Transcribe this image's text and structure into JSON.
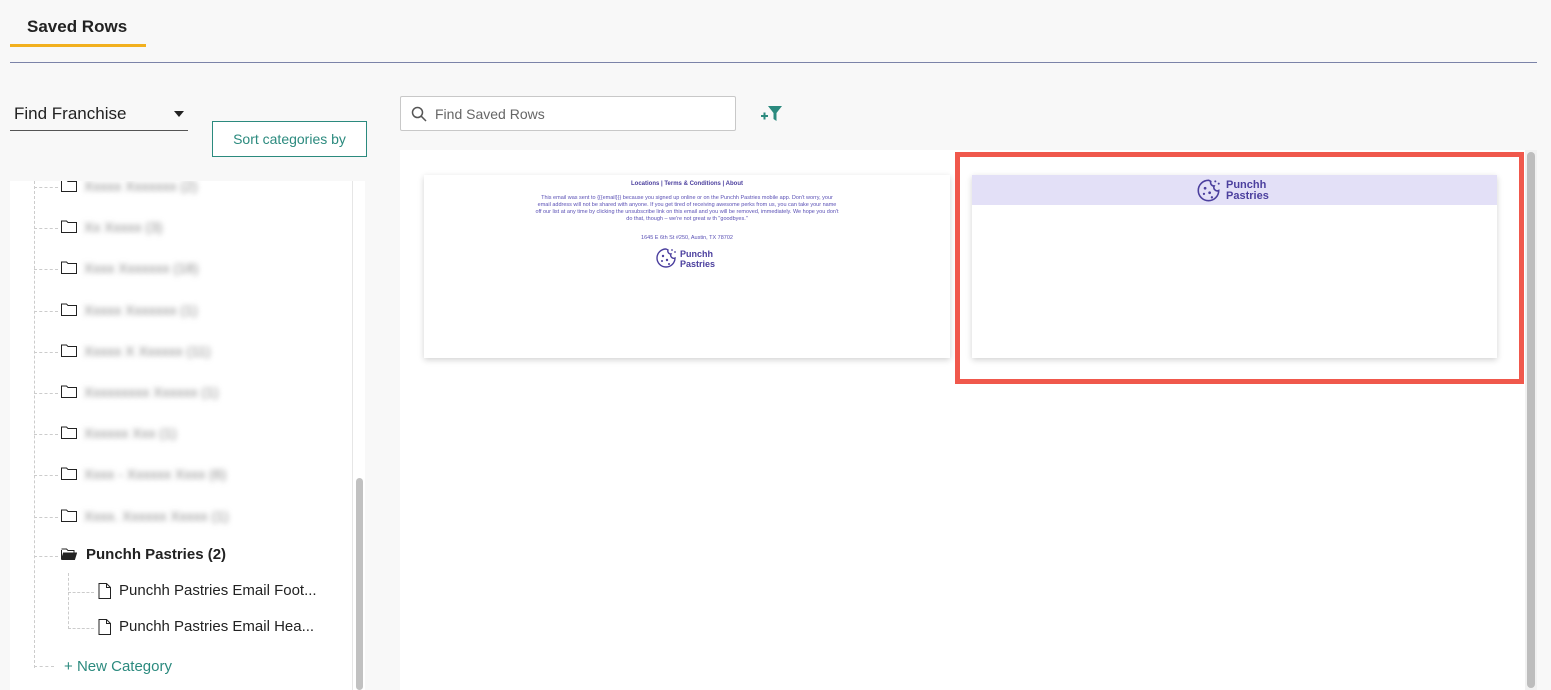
{
  "tab": {
    "label": "Saved Rows",
    "accent": "#f2b01e"
  },
  "franchise": {
    "label": "Find Franchise"
  },
  "sort": {
    "label": "Sort categories by"
  },
  "search": {
    "placeholder": "Find Saved Rows",
    "value": ""
  },
  "tree": {
    "hidden_items": [
      {
        "label": "Xxxxx Xxxxxxx (2)"
      },
      {
        "label": "Xx Xxxxx (3)"
      },
      {
        "label": "Xxxx Xxxxxxx (18)"
      },
      {
        "label": "Xxxxx Xxxxxxx (1)"
      },
      {
        "label": "Xxxxx X Xxxxxx (11)"
      },
      {
        "label": "Xxxxxxxxx Xxxxxx (1)"
      },
      {
        "label": "Xxxxxx Xxx (1)"
      },
      {
        "label": "Xxxx - Xxxxxx Xxxx (6)"
      },
      {
        "label": "Xxxx. Xxxxxx Xxxxx (1)"
      }
    ],
    "open_folder": {
      "label": "Punchh Pastries (2)"
    },
    "children": [
      {
        "label": "Punchh Pastries Email Foot..."
      },
      {
        "label": "Punchh Pastries Email Hea..."
      }
    ],
    "new_category": "New Category"
  },
  "cards": {
    "footer": {
      "links": "Locations | Terms & Conditions | About",
      "body": "This email was sent to {{{email}}} because you signed up online or on the Punchh Pastries mobile app. Don't worry, your email address will not be shared with anyone. If you get tired of receiving awesome perks from us, you can take your name off our list at any time by clicking the unsubscribe link on this email and you will be removed, immediately. We hope you don't do that, though – we're not great w th \"goodbyes.\"",
      "address": "1645 E 6th St #250, Austin, TX 78702"
    },
    "header": {}
  },
  "brand": {
    "line1": "Punchh",
    "line2": "Pastries",
    "color": "#4b3f9e"
  },
  "colors": {
    "teal": "#2b8a7e",
    "highlight": "#f0584c",
    "banner": "#e3e0f7"
  }
}
